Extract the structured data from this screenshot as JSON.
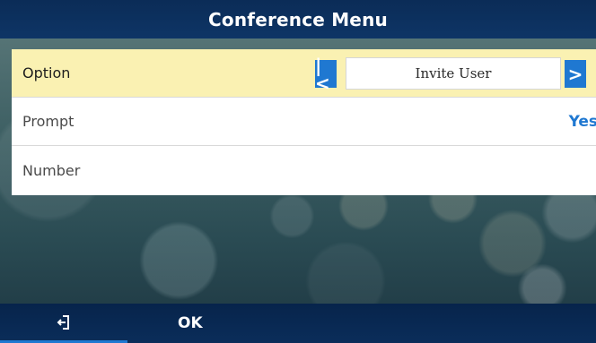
{
  "screen": {
    "title": "Conference Menu"
  },
  "menu": {
    "option_label": "Option",
    "option_value": "Invite User",
    "prompt_label": "Prompt",
    "prompt_value": "Yes",
    "number_label": "Number"
  },
  "softkeys": {
    "back_icon": "exit-icon",
    "ok_label": "OK"
  },
  "colors": {
    "accent": "#1f78d1",
    "highlight_row": "#faf1b2",
    "title_bar": "#0e3566"
  }
}
